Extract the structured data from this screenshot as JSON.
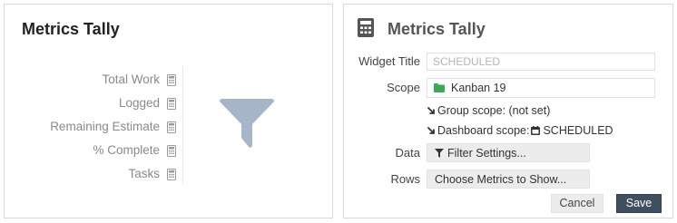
{
  "left_widget": {
    "title": "Metrics Tally",
    "metrics": [
      {
        "label": "Total Work"
      },
      {
        "label": "Logged"
      },
      {
        "label": "Remaining Estimate"
      },
      {
        "label": "% Complete"
      },
      {
        "label": "Tasks"
      }
    ],
    "metric_icon": "calculator-icon",
    "placeholder_icon": "funnel-icon"
  },
  "right_widget": {
    "header_icon": "calculator-icon",
    "title": "Metrics Tally",
    "widget_title_label": "Widget Title",
    "widget_title_placeholder": "SCHEDULED",
    "scope_label": "Scope",
    "scope_icon": "folder-icon",
    "scope_value": "Kanban 19",
    "group_scope_text": "Group scope: (not set)",
    "dashboard_scope_prefix": "Dashboard scope:",
    "dashboard_scope_value": "SCHEDULED",
    "data_label": "Data",
    "filter_button_label": "Filter Settings...",
    "rows_label": "Rows",
    "metrics_button_label": "Choose Metrics to Show...",
    "cancel_label": "Cancel",
    "save_label": "Save"
  },
  "colors": {
    "save_button": "#404f60",
    "folder_icon": "#3aaa5a",
    "funnel_icon": "#a6b6c8"
  }
}
